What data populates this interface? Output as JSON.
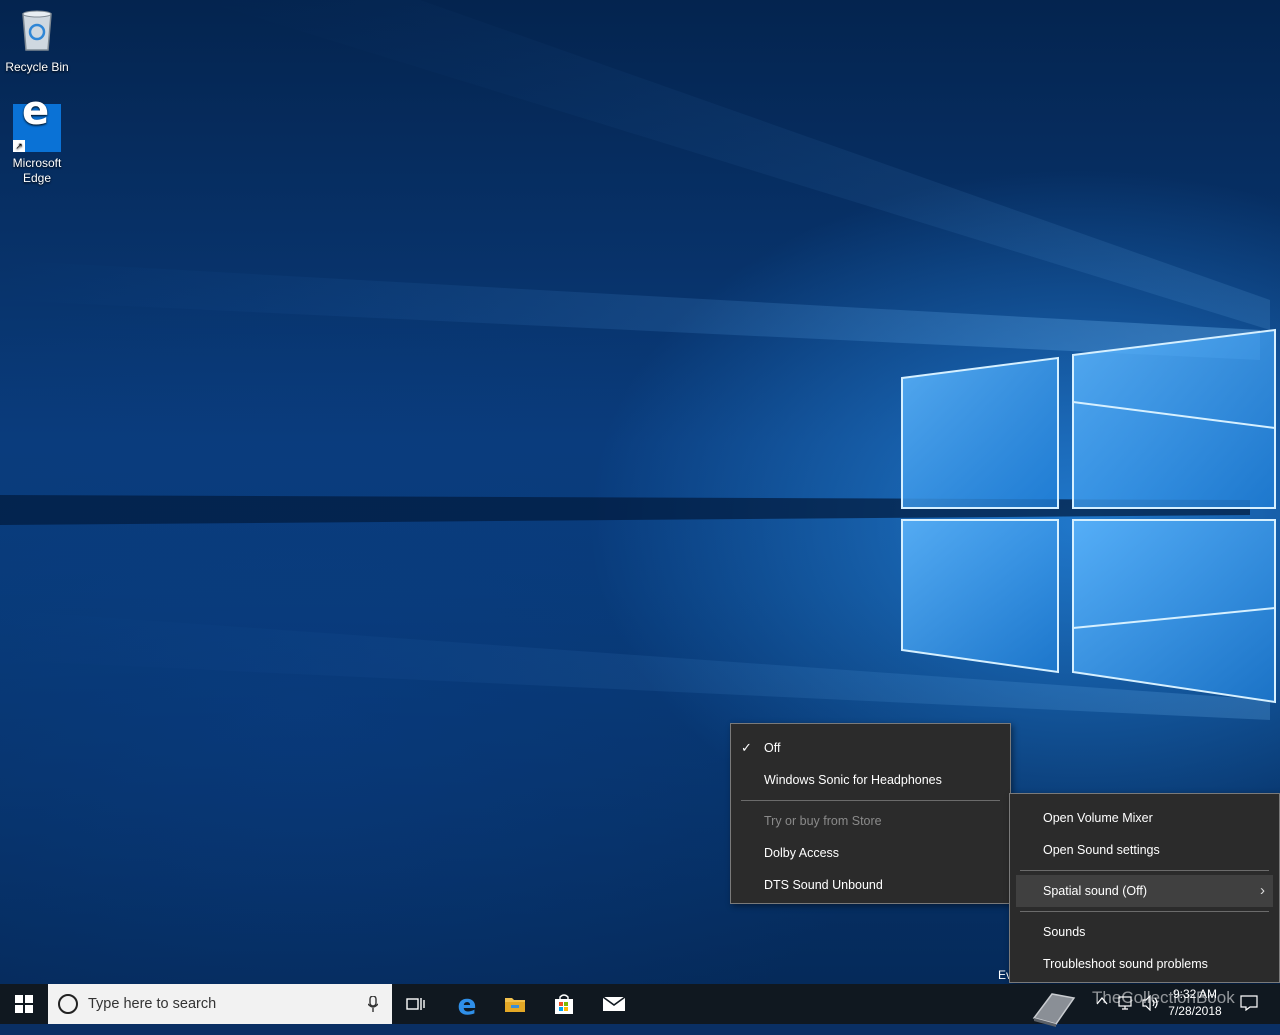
{
  "desktop": {
    "icons": [
      {
        "label": "Recycle Bin"
      },
      {
        "label": "Microsoft\nEdge"
      }
    ],
    "partial_text": "Ev"
  },
  "spatial_submenu": {
    "items": [
      {
        "label": "Off",
        "checked": true
      },
      {
        "label": "Windows Sonic for Headphones"
      },
      {
        "label": "Try or buy from Store",
        "disabled": true
      },
      {
        "label": "Dolby Access"
      },
      {
        "label": "DTS Sound Unbound"
      }
    ]
  },
  "sound_menu": {
    "items": [
      {
        "label": "Open Volume Mixer"
      },
      {
        "label": "Open Sound settings"
      },
      {
        "label": "Spatial sound (Off)",
        "has_submenu": true
      },
      {
        "label": "Sounds"
      },
      {
        "label": "Troubleshoot sound problems"
      }
    ]
  },
  "taskbar": {
    "search_placeholder": "Type here to search",
    "pinned": [
      "task-view-icon",
      "edge-icon",
      "file-explorer-icon",
      "store-icon",
      "mail-icon"
    ],
    "clock": {
      "time": "9:32 AM",
      "date": "7/28/2018"
    }
  },
  "watermark": "TheCollectionBook"
}
